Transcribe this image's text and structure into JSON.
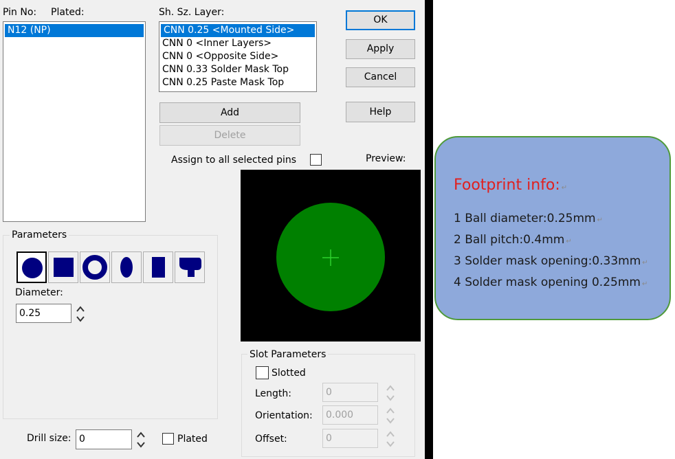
{
  "pins": {
    "pin_no_label": "Pin No:",
    "plated_label": "Plated:",
    "items": [
      "N12 (NP)"
    ]
  },
  "layers": {
    "header": "Sh. Sz. Layer:",
    "items": [
      "CNN 0.25 <Mounted Side>",
      "CNN 0 <Inner Layers>",
      "CNN 0 <Opposite Side>",
      "CNN 0.33 Solder Mask Top",
      "CNN 0.25 Paste Mask Top"
    ],
    "selected_index": 0
  },
  "buttons": {
    "ok": "OK",
    "apply": "Apply",
    "cancel": "Cancel",
    "help": "Help",
    "add": "Add",
    "delete": "Delete"
  },
  "assign_label": "Assign to all selected pins",
  "preview_label": "Preview:",
  "parameters": {
    "title": "Parameters",
    "shape_icons": [
      "round-pad-icon",
      "square-pad-icon",
      "annular-ring-icon",
      "oval-pad-icon",
      "rectangle-pad-icon",
      "odd-shape-pad-icon"
    ],
    "selected_shape": "round-pad-icon",
    "diameter_label": "Diameter:",
    "diameter_value": "0.25"
  },
  "drill": {
    "label": "Drill size:",
    "value": "0",
    "plated_label": "Plated"
  },
  "slot": {
    "title": "Slot Parameters",
    "slotted_label": "Slotted",
    "length_label": "Length:",
    "length_value": "0",
    "orientation_label": "Orientation:",
    "orientation_value": "0.000",
    "offset_label": "Offset:",
    "offset_value": "0"
  },
  "note": {
    "title": "Footprint info:",
    "lines": [
      "1 Ball diameter:0.25mm",
      "2 Ball pitch:0.4mm",
      "3 Solder mask opening:0.33mm",
      "4 Solder mask opening 0.25mm"
    ],
    "paragraph_mark": "↵"
  },
  "colors": {
    "selection": "#0078d7",
    "pad_fill": "#008000",
    "crosshair": "#2ed12e",
    "shape_fill": "#000080",
    "note_bg": "#8ea9db",
    "note_border": "#4f9a3a",
    "note_title": "#e0201f"
  }
}
